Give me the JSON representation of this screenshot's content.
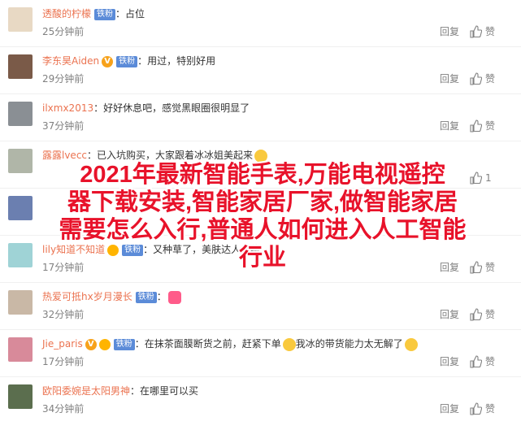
{
  "comments": [
    {
      "username": "透酸的柠檬",
      "badge": "铁粉",
      "text": "占位",
      "time": "25分钟前",
      "reply": "回复",
      "like": "赞",
      "verified": false,
      "medal": false,
      "emoji": false,
      "avatar_color": "#e8d9c4"
    },
    {
      "username": "李东昊Aiden",
      "badge": "铁粉",
      "text": "用过，特别好用",
      "time": "29分钟前",
      "reply": "回复",
      "like": "赞",
      "verified": true,
      "medal": false,
      "emoji": false,
      "avatar_color": "#7a5a48"
    },
    {
      "username": "ilxmx2013",
      "badge": "",
      "text": "好好休息吧，感觉黑眼圈很明显了",
      "time": "37分钟前",
      "reply": "回复",
      "like": "赞",
      "verified": false,
      "medal": false,
      "emoji": false,
      "avatar_color": "#8a8f94"
    },
    {
      "username": "露露lvecc",
      "badge": "",
      "text": "已入坑购买，大家跟着冰冰姐美起来",
      "time": "",
      "reply": "",
      "like": "1",
      "verified": false,
      "medal": false,
      "emoji": true,
      "avatar_color": "#b0b6a8"
    },
    {
      "username": "",
      "badge": "",
      "text": "",
      "time": "",
      "reply": "",
      "like": "",
      "verified": false,
      "medal": true,
      "emoji": false,
      "avatar_color": "#6b7fb0"
    },
    {
      "username": "lily知道不知道",
      "badge": "铁粉",
      "text": "又种草了，美肤达人！绝",
      "time": "17分钟前",
      "reply": "回复",
      "like": "赞",
      "verified": false,
      "medal": true,
      "emoji": false,
      "avatar_color": "#9fd3d6"
    },
    {
      "username": "热爱可抵hx岁月漫长",
      "badge": "铁粉",
      "text": "",
      "time": "32分钟前",
      "reply": "回复",
      "like": "赞",
      "verified": false,
      "medal": false,
      "emoji": true,
      "avatar_color": "#c9b8a6"
    },
    {
      "username": "Jie_paris",
      "badge": "铁粉",
      "text": "在抹茶面膜断货之前，赶紧下单",
      "text2": "我冰的带货能力太无解了",
      "time": "17分钟前",
      "reply": "回复",
      "like": "赞",
      "verified": true,
      "medal": true,
      "emoji": true,
      "avatar_color": "#d88a9a"
    },
    {
      "username": "欧阳委婉是太阳男神",
      "badge": "",
      "text": "在哪里可以买",
      "time": "34分钟前",
      "reply": "回复",
      "like": "赞",
      "verified": false,
      "medal": false,
      "emoji": false,
      "avatar_color": "#5b6e4e"
    }
  ],
  "overlay": {
    "line1": "2021年最新智能手表,万能电视遥控",
    "line2": "器下载安装,智能家居厂家,做智能家居",
    "line3": "需要怎么入行,普通人如何进入人工智能",
    "line4": "行业"
  },
  "colors": {
    "username": "#eb7350",
    "badge": "#5b8bd8",
    "meta": "#808080",
    "overlay_text": "#e8122a"
  }
}
